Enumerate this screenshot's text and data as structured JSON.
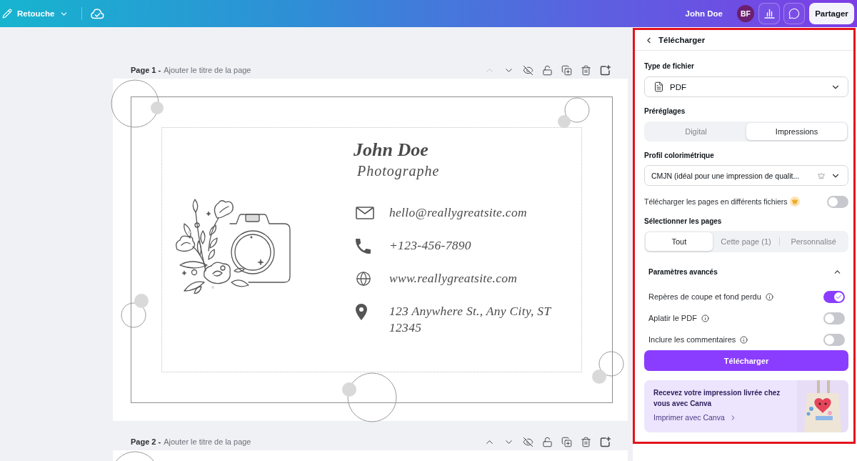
{
  "top_bar": {
    "edit_menu": "Retouche",
    "user_name": "John Doe",
    "avatar_initials": "BF",
    "share_button": "Partager"
  },
  "pages": [
    {
      "label": "Page 1 -",
      "title_placeholder": "Ajouter le titre de la page",
      "move_up_disabled": true,
      "card": {
        "name": "John Doe",
        "title": "Photographe",
        "contacts": [
          {
            "kind": "email",
            "text": "hello@reallygreatsite.com"
          },
          {
            "kind": "phone",
            "text": "+123-456-7890"
          },
          {
            "kind": "web",
            "text": "www.reallygreatsite.com"
          },
          {
            "kind": "address",
            "text": "123 Anywhere St., Any City, ST 12345"
          }
        ]
      }
    },
    {
      "label": "Page 2 -",
      "title_placeholder": "Ajouter le titre de la page",
      "move_up_disabled": false
    }
  ],
  "download_panel": {
    "title": "Télécharger",
    "file_type": {
      "label": "Type de fichier",
      "value": "PDF"
    },
    "presets": {
      "label": "Préréglages",
      "options": [
        {
          "label": "Digital",
          "selected": false
        },
        {
          "label": "Impressions",
          "selected": true
        }
      ]
    },
    "color_profile": {
      "label": "Profil colorimétrique",
      "value": "CMJN (idéal pour une impression de qualit...",
      "premium": true
    },
    "separate_files": {
      "label": "Télécharger les pages en différents fichiers",
      "premium": true,
      "on": false
    },
    "select_pages": {
      "label": "Sélectionner les pages",
      "options": [
        {
          "label": "Tout",
          "selected": true
        },
        {
          "label": "Cette page (1)",
          "selected": false
        },
        {
          "label": "Personnalisé",
          "selected": false
        }
      ]
    },
    "advanced": {
      "label": "Paramètres avancés",
      "expanded": true,
      "options": [
        {
          "label": "Repères de coupe et fond perdu",
          "on": true
        },
        {
          "label": "Aplatir le PDF",
          "on": false
        },
        {
          "label": "Inclure les commentaires",
          "on": false
        }
      ]
    },
    "download_button": "Télécharger",
    "promo": {
      "text": "Recevez votre impression livrée chez vous avec Canva",
      "link": "Imprimer avec Canva"
    }
  }
}
